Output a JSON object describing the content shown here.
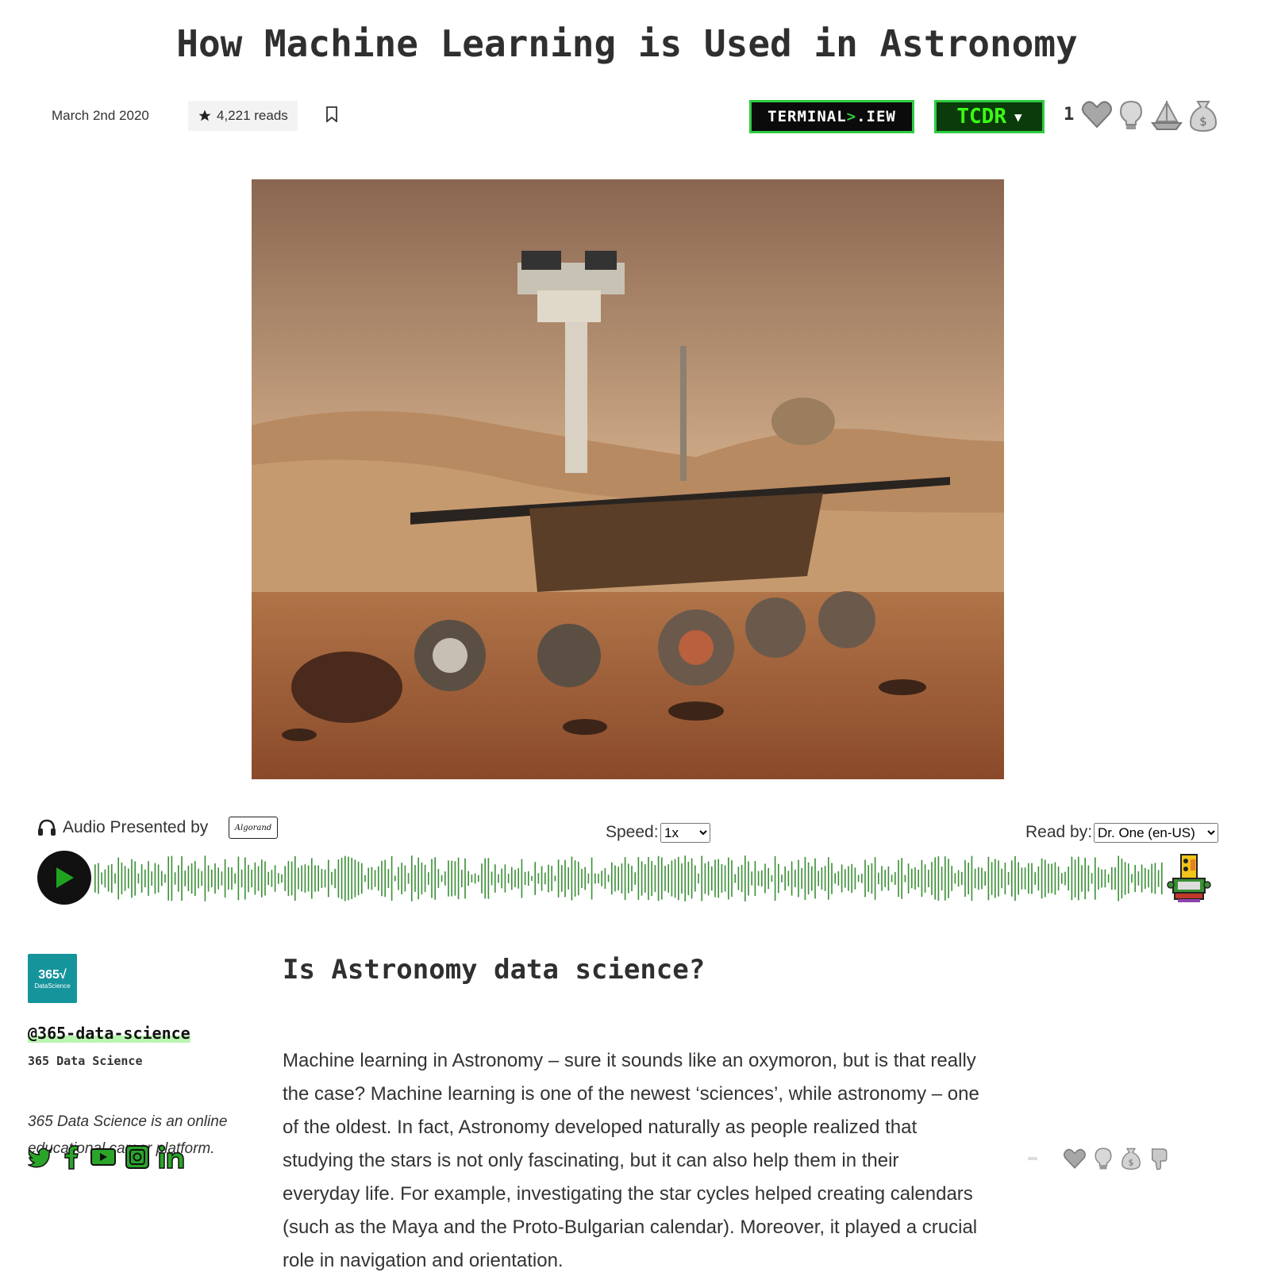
{
  "article": {
    "title": "How Machine Learning is Used in Astronomy",
    "date": "March 2nd 2020",
    "reads": "4,221 reads",
    "subheading": "Is Astronomy data science?",
    "body": "Machine learning in Astronomy – sure it sounds like an oxymoron, but is that really the case? Machine learning is one of the newest ‘sciences’, while astronomy – one of the oldest. In fact, Astronomy developed naturally as people realized that studying the stars is not only fascinating, but it can also help them in their everyday life. For example, investigating the star cycles helped creating calendars (such as the Maya and the Proto-Bulgarian calendar). Moreover, it played a crucial role in navigation and orientation."
  },
  "header": {
    "terminal_view": {
      "prefix": "TERMINAL ",
      "gt": ">",
      "suffix": ".IEW"
    },
    "language_button": "TCDR",
    "language_caret": "▼",
    "reaction_count": "1",
    "reaction_icons": [
      "heart-icon",
      "lightbulb-icon",
      "boat-icon",
      "money-bag-icon"
    ]
  },
  "hero": {
    "alt": "Mars rover on the Martian surface"
  },
  "audio": {
    "presented_by": "Audio Presented by",
    "sponsor": "Algorand",
    "speed_label": "Speed:",
    "speed_value": "1x",
    "read_by_label": "Read by:",
    "voice_value": "Dr. One (en-US)",
    "play_icon": "play-icon"
  },
  "author": {
    "avatar_line1": "365√",
    "avatar_line2": "DataScience",
    "handle": "@365-data-science",
    "name": "365 Data Science",
    "bio": "365 Data Science is an online educational career platform.",
    "socials": [
      "twitter-icon",
      "facebook-icon",
      "youtube-icon",
      "instagram-icon",
      "linkedin-icon"
    ]
  },
  "side_reactions": [
    "heart-icon",
    "lightbulb-icon",
    "money-bag-icon",
    "thumbs-down-icon"
  ],
  "colors": {
    "accent_green": "#2ecc40",
    "waveform": "#3a8f35",
    "avatar_teal": "#16949c"
  }
}
